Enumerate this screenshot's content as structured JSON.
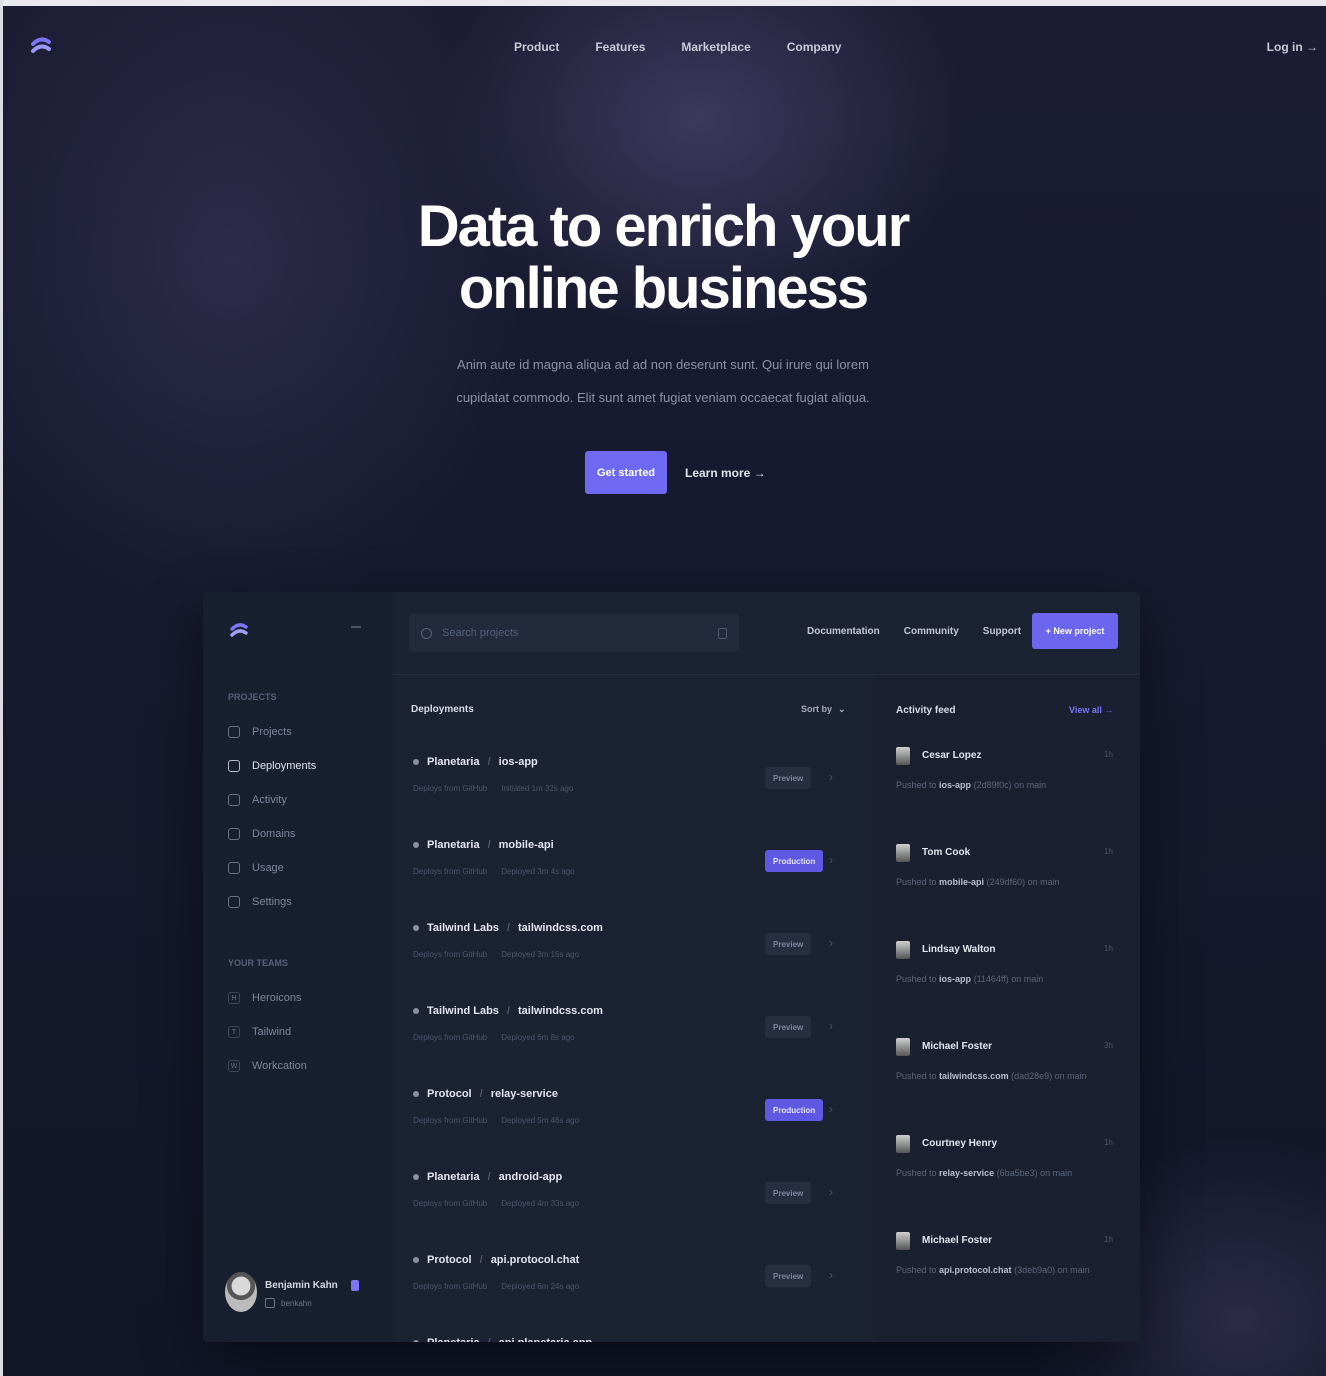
{
  "nav": {
    "links": [
      "Product",
      "Features",
      "Marketplace",
      "Company"
    ],
    "login": "Log in →"
  },
  "hero": {
    "title_line1": "Data to enrich your",
    "title_line2": "online business",
    "subtitle_line1": "Anim aute id magna aliqua ad ad non deserunt sunt. Qui irure qui lorem",
    "subtitle_line2": "cupidatat commodo. Elit sunt amet fugiat veniam occaecat fugiat aliqua.",
    "primary_cta": "Get started",
    "secondary_cta": "Learn more →"
  },
  "app": {
    "search_placeholder": "Search projects",
    "top_links": [
      "Documentation",
      "Community",
      "Support"
    ],
    "new_button": "+ New project",
    "sidebar": {
      "section_projects": "PROJECTS",
      "items": [
        "Projects",
        "Deployments",
        "Activity",
        "Domains",
        "Usage",
        "Settings"
      ],
      "active_index": 1,
      "section_teams": "YOUR TEAMS",
      "teams": [
        {
          "initial": "H",
          "name": "Heroicons"
        },
        {
          "initial": "T",
          "name": "Tailwind"
        },
        {
          "initial": "W",
          "name": "Workcation"
        }
      ],
      "profile": {
        "name": "Benjamin Kahn",
        "handle": "benkahn"
      }
    },
    "deployments": {
      "title": "Deployments",
      "sort_label": "Sort by",
      "items": [
        {
          "team": "Planetaria",
          "project": "ios-app",
          "meta1": "Deploys from GitHub",
          "meta2": "Initiated 1m 32s ago",
          "env": "Preview"
        },
        {
          "team": "Planetaria",
          "project": "mobile-api",
          "meta1": "Deploys from GitHub",
          "meta2": "Deployed 3m 4s ago",
          "env": "Production"
        },
        {
          "team": "Tailwind Labs",
          "project": "tailwindcss.com",
          "meta1": "Deploys from GitHub",
          "meta2": "Deployed 3m 16s ago",
          "env": "Preview"
        },
        {
          "team": "Tailwind Labs",
          "project": "tailwindcss.com",
          "meta1": "Deploys from GitHub",
          "meta2": "Deployed 6m 8s ago",
          "env": "Preview"
        },
        {
          "team": "Protocol",
          "project": "relay-service",
          "meta1": "Deploys from GitHub",
          "meta2": "Deployed 5m 46s ago",
          "env": "Production"
        },
        {
          "team": "Planetaria",
          "project": "android-app",
          "meta1": "Deploys from GitHub",
          "meta2": "Deployed 4m 33s ago",
          "env": "Preview"
        },
        {
          "team": "Protocol",
          "project": "api.protocol.chat",
          "meta1": "Deploys from GitHub",
          "meta2": "Deployed 6m 24s ago",
          "env": "Preview"
        },
        {
          "team": "Planetaria",
          "project": "api.planetaria.app",
          "meta1": "",
          "meta2": "",
          "env": ""
        }
      ]
    },
    "feed": {
      "title": "Activity feed",
      "view_all": "View all →",
      "items": [
        {
          "name": "Cesar Lopez",
          "time": "1h",
          "action": "Pushed to",
          "target": "ios-app",
          "detail": "(2d89f0c) on main"
        },
        {
          "name": "Tom Cook",
          "time": "1h",
          "action": "Pushed to",
          "target": "mobile-api",
          "detail": "(249df60) on main"
        },
        {
          "name": "Lindsay Walton",
          "time": "1h",
          "action": "Pushed to",
          "target": "ios-app",
          "detail": "(11464ff) on main"
        },
        {
          "name": "Michael Foster",
          "time": "3h",
          "action": "Pushed to",
          "target": "tailwindcss.com",
          "detail": "(dad28e9) on main"
        },
        {
          "name": "Courtney Henry",
          "time": "1h",
          "action": "Pushed to",
          "target": "relay-service",
          "detail": "(6ba5be3) on main"
        },
        {
          "name": "Michael Foster",
          "time": "1h",
          "action": "Pushed to",
          "target": "api.protocol.chat",
          "detail": "(3deb9a0) on main"
        }
      ]
    }
  },
  "colors": {
    "accent": "#6f69f2",
    "background": "#121526",
    "panel": "#1b2232"
  }
}
